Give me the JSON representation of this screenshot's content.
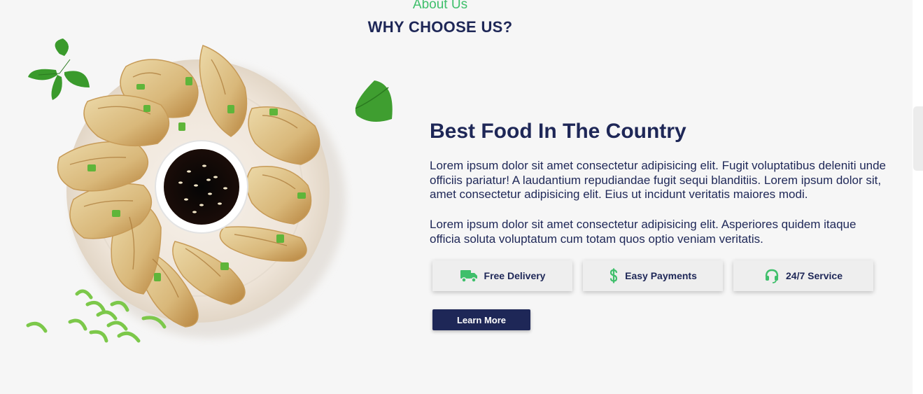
{
  "section": {
    "eyebrow": "About Us",
    "title": "WHY CHOOSE US?"
  },
  "content": {
    "heading": "Best Food In The Country",
    "paragraph1_lines": [
      "Lorem ipsum dolor sit amet consectetur adipisicing elit. Fugit voluptatibus deleniti unde",
      "officiis pariatur! A laudantium repudiandae fugit sequi blanditiis. Lorem ipsum dolor sit,",
      "amet consectetur adipisicing elit. Eius ut incidunt veritatis maiores modi."
    ],
    "paragraph2_lines": [
      "Lorem ipsum dolor sit amet consectetur adipisicing elit. Asperiores quidem itaque",
      "officia soluta voluptatum cum totam quos optio veniam veritatis."
    ]
  },
  "features": [
    {
      "label": "Free Delivery",
      "icon": "truck-icon"
    },
    {
      "label": "Easy Payments",
      "icon": "dollar-icon"
    },
    {
      "label": "24/7 Service",
      "icon": "headset-icon"
    }
  ],
  "cta": {
    "label": "Learn More"
  },
  "colors": {
    "accent": "#3fbf6b",
    "navy": "#1e2757",
    "background": "#f6f6f6"
  }
}
